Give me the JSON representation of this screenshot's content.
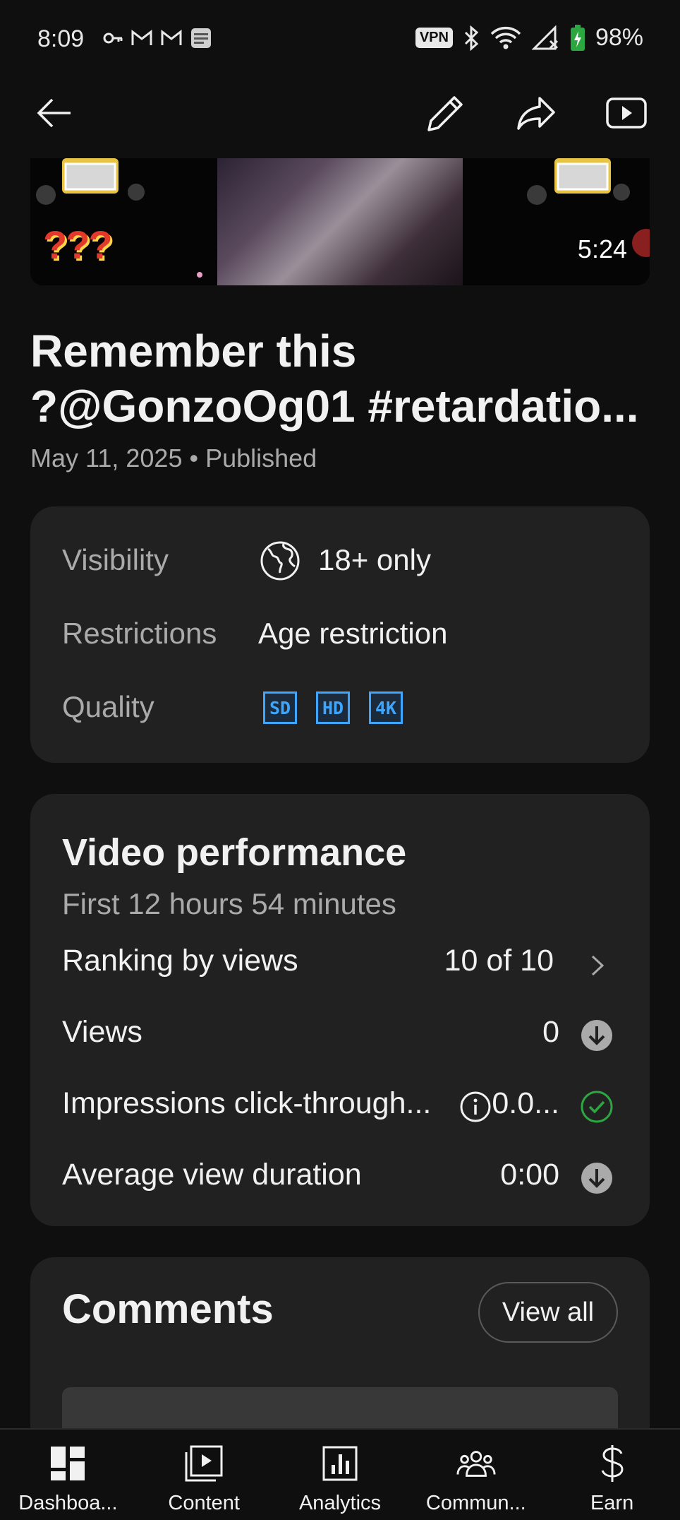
{
  "status_bar": {
    "time": "8:09",
    "vpn": "VPN",
    "battery": "98%"
  },
  "toolbar": {
    "back_icon": "arrow-left-icon",
    "edit_icon": "pencil-icon",
    "share_icon": "share-arrow-icon",
    "youtube_icon": "youtube-play-icon"
  },
  "video": {
    "duration": "5:24",
    "thumb_overlay": "???",
    "title_line1": "Remember this",
    "title_line2": "?@GonzoOg01 #retardatio...",
    "date_status": "May 11, 2025 • Published"
  },
  "details": {
    "visibility_label": "Visibility",
    "visibility_value": "18+ only",
    "restrictions_label": "Restrictions",
    "restrictions_value": "Age restriction",
    "quality_label": "Quality",
    "quality_badges": [
      "SD",
      "HD",
      "4K"
    ]
  },
  "performance": {
    "title": "Video performance",
    "subtitle": "First 12 hours 54 minutes",
    "rows": [
      {
        "label": "Ranking by views",
        "value": "10 of 10",
        "icon": "chevron-right-icon"
      },
      {
        "label": "Views",
        "value": "0",
        "icon": "arrow-down-circle-icon"
      },
      {
        "label": "Impressions click-through...",
        "value": "0.0...",
        "icon": "check-circle-icon"
      },
      {
        "label": "Average view duration",
        "value": "0:00",
        "icon": "arrow-down-circle-icon"
      }
    ],
    "colors": {
      "check": "#2ba640",
      "down": "#aaaaaa"
    }
  },
  "comments": {
    "title": "Comments",
    "view_all": "View all"
  },
  "bottom_nav": [
    {
      "label": "Dashboa...",
      "icon": "dashboard-icon"
    },
    {
      "label": "Content",
      "icon": "content-icon"
    },
    {
      "label": "Analytics",
      "icon": "analytics-icon"
    },
    {
      "label": "Commun...",
      "icon": "community-icon"
    },
    {
      "label": "Earn",
      "icon": "dollar-icon"
    }
  ],
  "colors": {
    "background": "#0f0f0f",
    "card": "#212121",
    "accent_blue": "#3ea6ff"
  }
}
